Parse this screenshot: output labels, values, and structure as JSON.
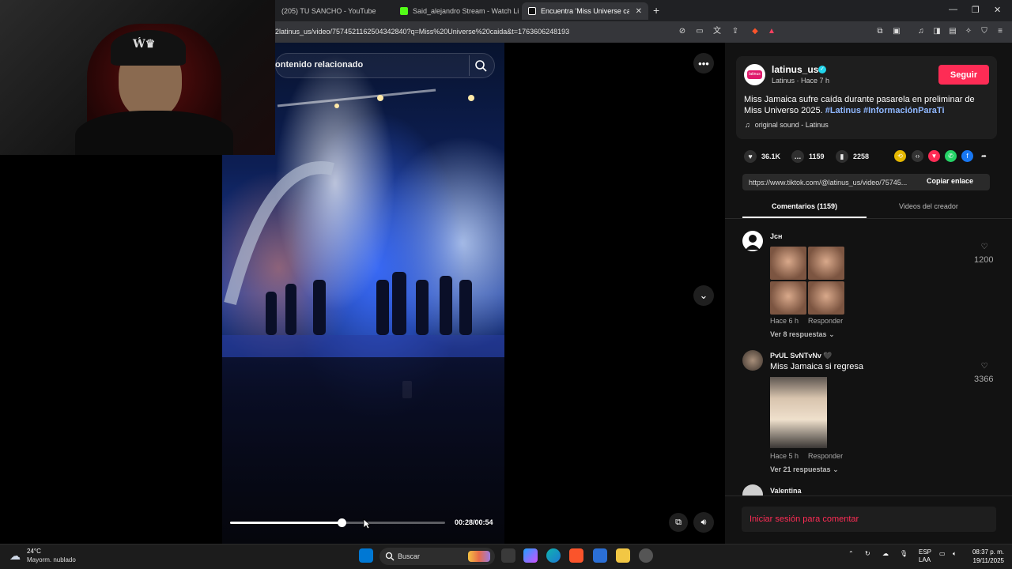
{
  "browser": {
    "tabs": [
      {
        "label": "(205) TU SANCHO - YouTube",
        "active": false,
        "favicon_color": "#ff0000"
      },
      {
        "label": "Said_alejandro Stream - Watch Live o",
        "active": false,
        "favicon_color": "#53fc18"
      },
      {
        "label": "Encuentra 'Miss Universe caíd",
        "active": true,
        "favicon_color": "#ffffff"
      }
    ],
    "url": "2latinus_us/video/7574521162504342840?q=Miss%20Universe%20caida&t=1763606248193"
  },
  "video": {
    "search_placeholder": "ontenido relacionado",
    "progress": 0.52,
    "time_display": "00:28/00:54"
  },
  "post": {
    "username": "latinus_us",
    "display_name": "Latinus",
    "time_ago": "Hace 7 h",
    "subline": "Latinus · Hace 7 h",
    "follow_label": "Seguir",
    "description": "Miss Jamaica sufre caída durante pasarela en preliminar de Miss Universo 2025.",
    "hashtags": "#Latinus #InformaciónParaTi",
    "sound": "original sound - Latinus",
    "likes": "36.1K",
    "comments": "1159",
    "saves": "2258",
    "link": "https://www.tiktok.com/@latinus_us/video/75745...",
    "copy_label": "Copiar enlace",
    "avatar_text": "latinus"
  },
  "tabs": {
    "comments_label": "Comentarios (1159)",
    "videos_label": "Videos del creador"
  },
  "comments": [
    {
      "name": "Jᴄʜ",
      "text": "",
      "time": "Hace 6 h",
      "reply_label": "Responder",
      "replies": "Ver 8 respuestas",
      "likes": "1200"
    },
    {
      "name": "PvUL SvNTvNv 🖤",
      "text": "Miss Jamaica si regresa",
      "time": "Hace 5 h",
      "reply_label": "Responder",
      "replies": "Ver 21 respuestas",
      "likes": "3366"
    },
    {
      "name": "Valentina",
      "text": "",
      "time": "",
      "reply_label": "",
      "replies": "",
      "likes": ""
    }
  ],
  "comment_box": {
    "login_label": "Iniciar sesión para comentar"
  },
  "taskbar": {
    "temperature": "24°C",
    "weather": "Mayorm. nublado",
    "search_label": "Buscar",
    "lang_top": "ESP",
    "lang_bottom": "LAA",
    "time": "08:37 p. m.",
    "date": "19/11/2025"
  },
  "colors": {
    "accent": "#fe2c55",
    "hashtag": "#8fb7ff",
    "verified": "#20d5ec"
  }
}
